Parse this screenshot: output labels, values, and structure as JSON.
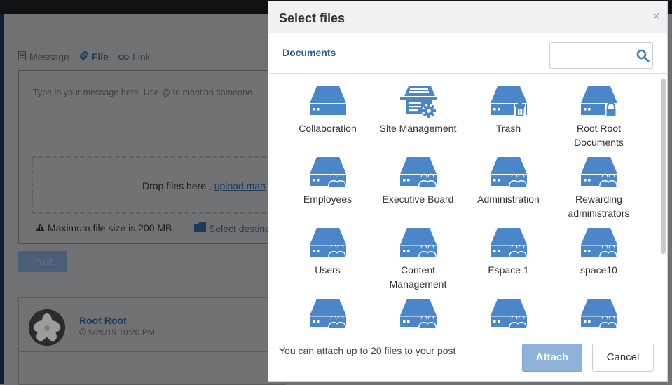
{
  "composer": {
    "tabs": [
      {
        "label": "Message",
        "icon": "document-icon"
      },
      {
        "label": "File",
        "icon": "paperclip-icon"
      },
      {
        "label": "Link",
        "icon": "link-icon"
      }
    ],
    "placeholder": "Type in your message here. Use @ to mention someone.",
    "drop_text": "Drop files here ,",
    "upload_link": "upload man",
    "max_size": "Maximum file size is 200 MB",
    "destination": "Select destina",
    "post_label": "Post"
  },
  "activity": {
    "author": "Root Root",
    "timestamp": "9/26/19 10:20 PM"
  },
  "modal": {
    "title": "Select files",
    "close_glyph": "×",
    "breadcrumb": "Documents",
    "search_value": "",
    "footer_note": "You can attach up to 20 files to your post",
    "attach_label": "Attach",
    "cancel_label": "Cancel",
    "icon_color": "#4a86c8",
    "drives": [
      {
        "label": "Collaboration",
        "badge": "none"
      },
      {
        "label": "Site Management",
        "badge": "gear"
      },
      {
        "label": "Trash",
        "badge": "trash"
      },
      {
        "label": "Root Root Documents",
        "badge": "lock"
      },
      {
        "label": "Employees",
        "badge": "users"
      },
      {
        "label": "Executive Board",
        "badge": "users"
      },
      {
        "label": "Administration",
        "badge": "users"
      },
      {
        "label": "Rewarding administrators",
        "badge": "users"
      },
      {
        "label": "Users",
        "badge": "users"
      },
      {
        "label": "Content Management",
        "badge": "users"
      },
      {
        "label": "Espace 1",
        "badge": "users"
      },
      {
        "label": "space10",
        "badge": "users"
      },
      {
        "label": "",
        "badge": "users"
      },
      {
        "label": "",
        "badge": "users"
      },
      {
        "label": "",
        "badge": "users"
      },
      {
        "label": "",
        "badge": "users"
      }
    ]
  }
}
